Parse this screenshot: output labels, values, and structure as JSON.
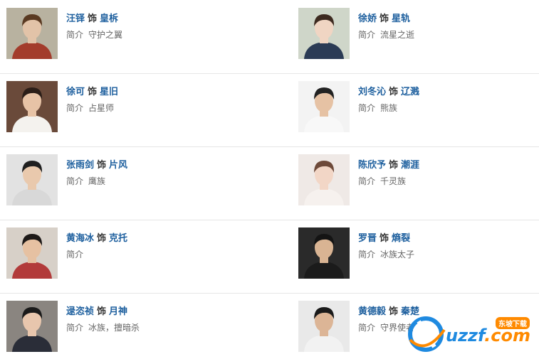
{
  "role_word": "饰",
  "intro_label": "简介",
  "cast": [
    {
      "actor": "汪铎",
      "role": "皇柝",
      "intro": "守护之翼",
      "photo_colors": {
        "bg": "#b8b2a0",
        "skin": "#e2c3a8",
        "hair": "#5a3a22",
        "top": "#a33c2c"
      }
    },
    {
      "actor": "徐娇",
      "role": "星轨",
      "intro": "流星之逝",
      "photo_colors": {
        "bg": "#cfd6c9",
        "skin": "#f0d5c3",
        "hair": "#3d2a20",
        "top": "#2b3b55"
      }
    },
    {
      "actor": "徐可",
      "role": "星旧",
      "intro": "占星师",
      "photo_colors": {
        "bg": "#6a4a3a",
        "skin": "#e7c3a6",
        "hair": "#2b1e18",
        "top": "#f4f2ee"
      }
    },
    {
      "actor": "刘冬沁",
      "role": "辽溅",
      "intro": "熊族",
      "photo_colors": {
        "bg": "#f3f3f3",
        "skin": "#e6c2a4",
        "hair": "#222222",
        "top": "#f8f8f8"
      }
    },
    {
      "actor": "张雨剑",
      "role": "片风",
      "intro": "鹰族",
      "photo_colors": {
        "bg": "#e2e2e2",
        "skin": "#e9c9ad",
        "hair": "#1f1f1f",
        "top": "#d8d8d8"
      }
    },
    {
      "actor": "陈欣予",
      "role": "潮涯",
      "intro": "千灵族",
      "photo_colors": {
        "bg": "#efe9e6",
        "skin": "#f2d6c6",
        "hair": "#6e4a3a",
        "top": "#f6f1ee"
      }
    },
    {
      "actor": "黄海冰",
      "role": "克托",
      "intro": "",
      "photo_colors": {
        "bg": "#d7d0c8",
        "skin": "#e6c1a2",
        "hair": "#1e1a18",
        "top": "#b23a3a"
      }
    },
    {
      "actor": "罗晋",
      "role": "熵裂",
      "intro": "冰族太子",
      "photo_colors": {
        "bg": "#2a2a2a",
        "skin": "#d9b493",
        "hair": "#141414",
        "top": "#1b1b1b"
      }
    },
    {
      "actor": "逯恣祯",
      "role": "月神",
      "intro": "冰族，擅暗杀",
      "photo_colors": {
        "bg": "#8a8580",
        "skin": "#e8c6ad",
        "hair": "#1a1a1a",
        "top": "#2a2d38"
      }
    },
    {
      "actor": "黄德毅",
      "role": "秦楚",
      "intro": "守界使者",
      "photo_colors": {
        "bg": "#e9e9e9",
        "skin": "#dcb596",
        "hair": "#1a1a1a",
        "top": "#f2f2f2"
      }
    }
  ],
  "watermark": {
    "text": "uzzf",
    "dot": ".com",
    "tag": "东坡下载"
  }
}
